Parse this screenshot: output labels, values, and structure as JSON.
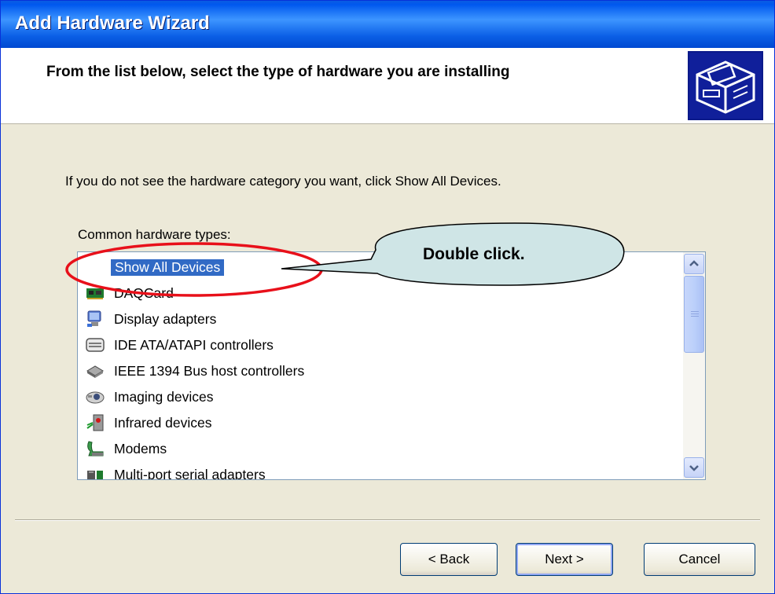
{
  "window": {
    "title": "Add Hardware Wizard"
  },
  "header": {
    "heading": "From the list below, select the type of hardware you are installing"
  },
  "body": {
    "instruction": "If you do not see the hardware category you want, click Show All Devices.",
    "list_label": "Common hardware types:"
  },
  "list": {
    "items": [
      {
        "label": "Show All Devices",
        "icon": "none",
        "selected": true
      },
      {
        "label": "DAQCard",
        "icon": "circuit-board-icon"
      },
      {
        "label": "Display adapters",
        "icon": "monitor-icon"
      },
      {
        "label": "IDE ATA/ATAPI controllers",
        "icon": "drive-controller-icon"
      },
      {
        "label": "IEEE 1394 Bus host controllers",
        "icon": "firewire-icon"
      },
      {
        "label": "Imaging devices",
        "icon": "camera-icon"
      },
      {
        "label": "Infrared devices",
        "icon": "infrared-icon"
      },
      {
        "label": "Modems",
        "icon": "modem-icon"
      },
      {
        "label": "Multi-port serial adapters",
        "icon": "serial-adapter-icon"
      }
    ]
  },
  "buttons": {
    "back": "< Back",
    "next": "Next >",
    "cancel": "Cancel"
  },
  "annotation": {
    "callout_text": "Double click."
  },
  "colors": {
    "title_bar": "#0058ee",
    "selection": "#316ac5",
    "callout_fill": "#cfe5e6",
    "highlight_ellipse": "#e8101a"
  }
}
